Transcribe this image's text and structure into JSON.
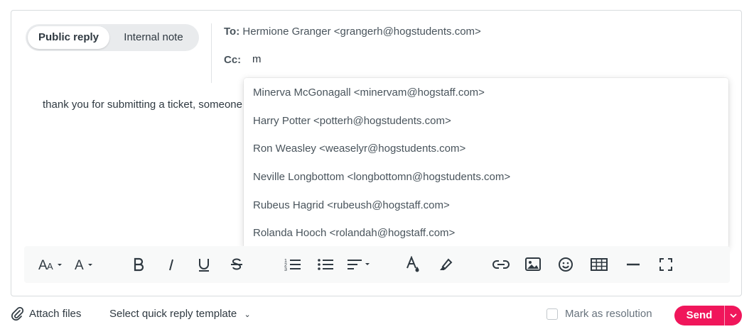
{
  "mode_toggle": {
    "public_reply": "Public reply",
    "internal_note": "Internal note"
  },
  "recipients": {
    "to_label": "To:",
    "to_value": "Hermione Granger <grangerh@hogstudents.com>",
    "cc_label": "Cc:",
    "cc_input_value": "m"
  },
  "editor": {
    "body_text": "thank you for submitting a ticket, someone"
  },
  "suggestions": [
    "Minerva McGonagall <minervam@hogstaff.com>",
    "Harry Potter <potterh@hogstudents.com>",
    "Ron Weasley <weaselyr@hogstudents.com>",
    "Neville Longbottom <longbottomn@hogstudents.com>",
    "Rubeus Hagrid <rubeush@hogstaff.com>",
    "Rolanda Hooch <rolandah@hogstaff.com>"
  ],
  "toolbar": {
    "icons": [
      "font-size-icon",
      "font-color-icon",
      "bold-icon",
      "italic-icon",
      "underline-icon",
      "strikethrough-icon",
      "numbered-list-icon",
      "bullet-list-icon",
      "align-icon",
      "text-color-icon",
      "highlight-icon",
      "link-icon",
      "image-icon",
      "emoji-icon",
      "table-icon",
      "horizontal-rule-icon",
      "fullscreen-icon"
    ]
  },
  "footer": {
    "attach_label": "Attach files",
    "template_label": "Select quick reply template",
    "resolution_label": "Mark as resolution",
    "send_label": "Send"
  },
  "colors": {
    "accent": "#f0165b",
    "text": "#2f3941",
    "toolbar_bg": "#f8f9f9"
  }
}
